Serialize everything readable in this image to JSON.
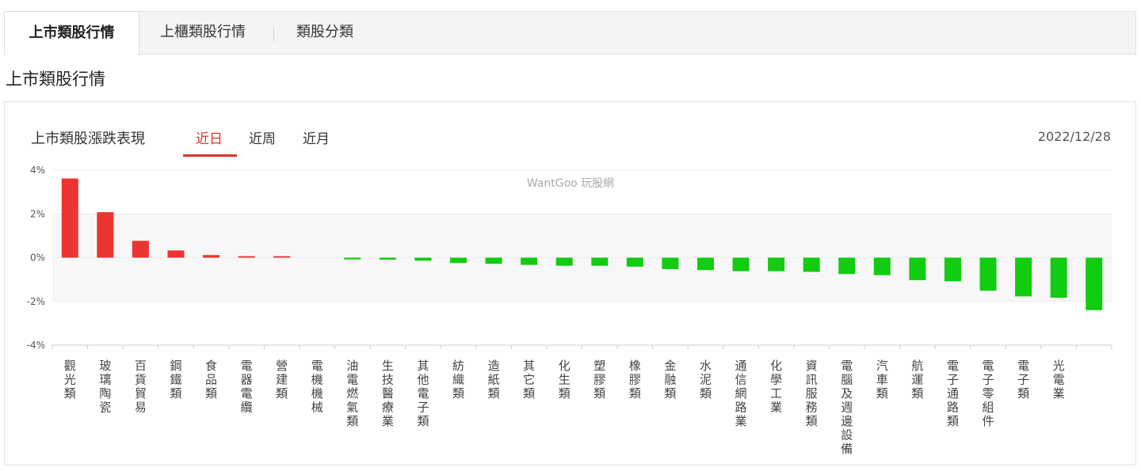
{
  "tabs": [
    {
      "label": "上市類股行情",
      "active": true
    },
    {
      "label": "上櫃類股行情",
      "active": false
    },
    {
      "label": "類股分類",
      "active": false
    }
  ],
  "section_title": "上市類股行情",
  "panel": {
    "title": "上市類股漲跌表現",
    "periods": [
      {
        "label": "近日",
        "active": true
      },
      {
        "label": "近周",
        "active": false
      },
      {
        "label": "近月",
        "active": false
      }
    ],
    "date": "2022/12/28",
    "watermark": "WantGoo 玩股網"
  },
  "colors": {
    "up": "#ee3333",
    "down": "#11cc11",
    "accent": "#d9342b"
  },
  "chart_data": {
    "type": "bar",
    "ylim": [
      -4,
      4
    ],
    "yticks": [
      "4%",
      "2%",
      "0%",
      "-2%",
      "-4%"
    ],
    "grid": true,
    "categories": [
      "觀光類",
      "玻璃陶瓷",
      "百貨貿易",
      "鋼鐵類",
      "食品類",
      "電器電纜",
      "營建類",
      "電機機械",
      "油電燃氣類",
      "生技醫療業",
      "其他電子類",
      "紡織類",
      "造紙類",
      "其它類",
      "化生類",
      "塑膠類",
      "橡膠類",
      "金融類",
      "水泥類",
      "通信網路業",
      "化學工業",
      "資訊服務類",
      "電腦及週邊設備",
      "汽車類",
      "航運類",
      "電子通路類",
      "電子零組件",
      "電子類",
      "光電業"
    ],
    "values": [
      3.62,
      2.08,
      0.77,
      0.33,
      0.12,
      0.07,
      0.07,
      0.0,
      -0.08,
      -0.09,
      -0.14,
      -0.24,
      -0.28,
      -0.33,
      -0.37,
      -0.37,
      -0.41,
      -0.52,
      -0.57,
      -0.62,
      -0.62,
      -0.65,
      -0.75,
      -0.8,
      -1.03,
      -1.08,
      -1.51,
      -1.77,
      -1.83,
      -2.4
    ]
  }
}
